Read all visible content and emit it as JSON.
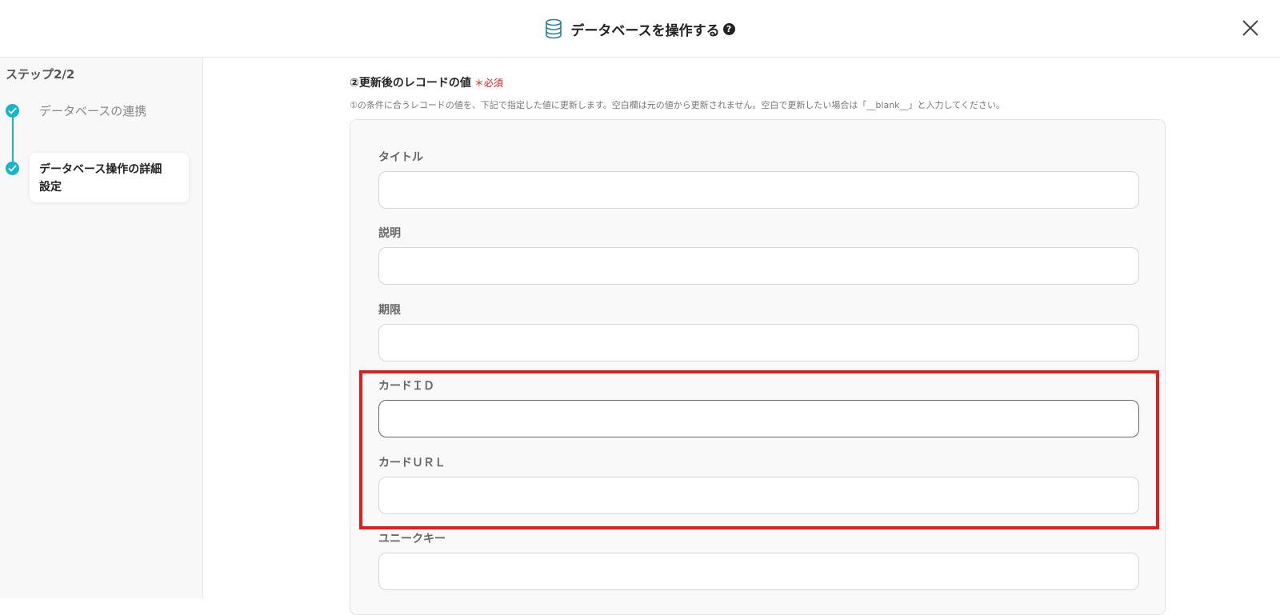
{
  "header": {
    "title": "データベースを操作する",
    "help_icon": "?",
    "icons": {
      "database": "database-icon",
      "help": "question-circle-icon",
      "close": "close-icon"
    }
  },
  "sidebar": {
    "step_label": "ステップ2/2",
    "steps": [
      {
        "label": "データベースの連携",
        "status": "complete"
      },
      {
        "label_line1": "データベース操作の詳細",
        "label_line2": "設定",
        "status": "current"
      }
    ]
  },
  "main": {
    "section_title": "②更新後のレコードの値",
    "required_label": "＊必須",
    "description": "①の条件に合うレコードの値を、下記で指定した値に更新します。空白欄は元の値から更新されません。空白で更新したい場合は「__blank__」と入力してください。",
    "fields": [
      {
        "label": "タイトル",
        "value": ""
      },
      {
        "label": "説明",
        "value": ""
      },
      {
        "label": "期限",
        "value": ""
      },
      {
        "label": "カードＩＤ",
        "value": ""
      },
      {
        "label": "カードＵＲＬ",
        "value": ""
      },
      {
        "label": "ユニークキー",
        "value": ""
      }
    ]
  },
  "colors": {
    "accent": "#18b4c8",
    "required": "#e02020",
    "highlight": "#e31c1c"
  }
}
